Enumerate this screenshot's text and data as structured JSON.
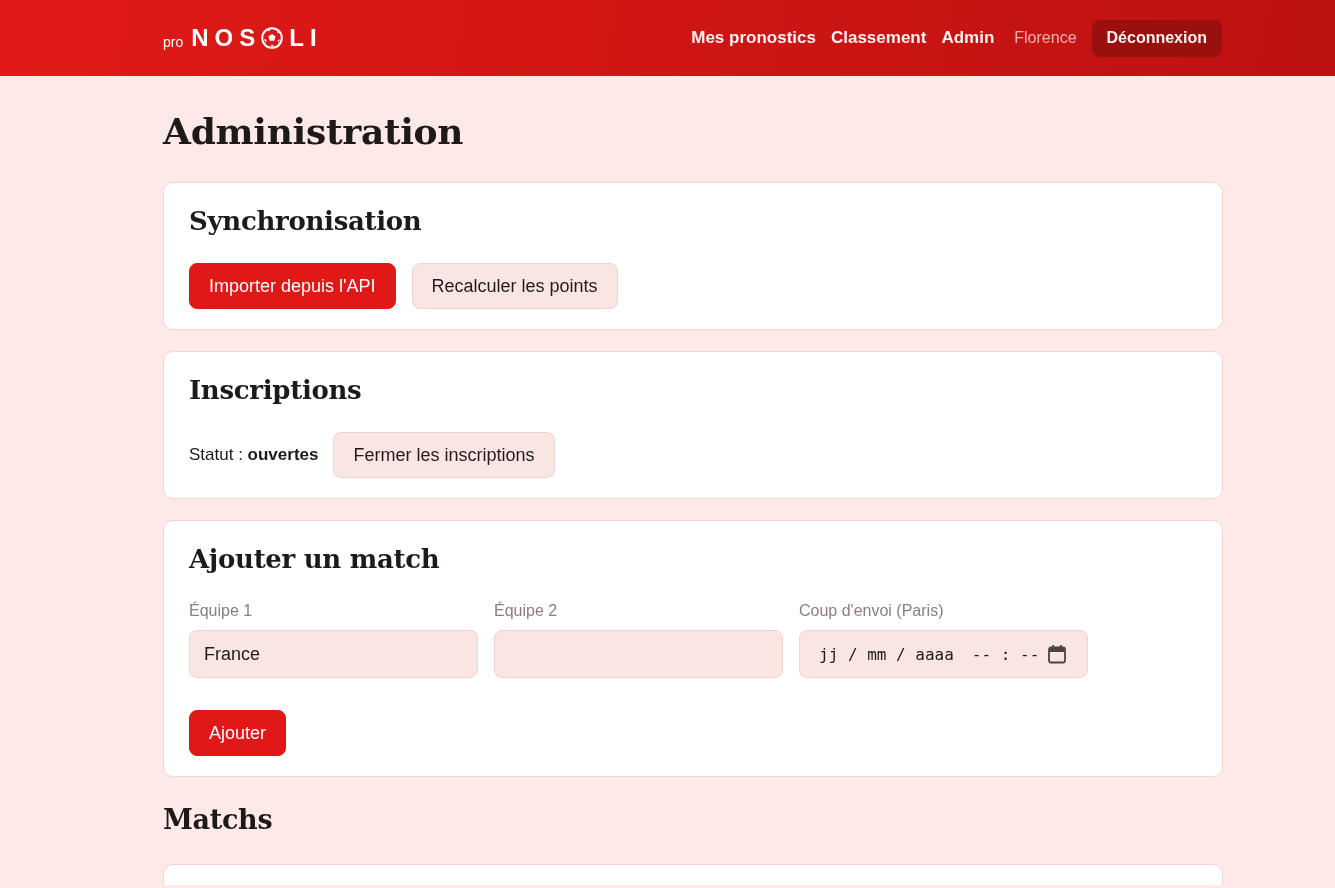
{
  "header": {
    "logo": {
      "prefix": "pro",
      "text_before_ball": "NOS",
      "text_after_ball": "LI"
    },
    "nav": [
      {
        "label": "Mes pronostics"
      },
      {
        "label": "Classement"
      },
      {
        "label": "Admin"
      }
    ],
    "user": "Florence",
    "logout_button": "Déconnexion"
  },
  "page_title": "Administration",
  "cards": [
    {
      "kind": "actions",
      "title": "Synchronisation",
      "buttons": [
        {
          "label": "Importer depuis l'API",
          "kind": "primary"
        },
        {
          "label": "Recalculer les points",
          "kind": "secondary"
        }
      ]
    },
    {
      "kind": "status",
      "title": "Inscriptions",
      "status": "Statut : **ouvertes**",
      "buttons": [
        {
          "label": "Fermer les inscriptions",
          "kind": "secondary"
        }
      ]
    },
    {
      "kind": "form",
      "title": "Ajouter un match",
      "fields": [
        {
          "kind": "text",
          "label": "Équipe 1",
          "value": "France"
        },
        {
          "kind": "text",
          "label": "Équipe 2"
        },
        {
          "kind": "datetime",
          "label": "Coup d'envoi (Paris)",
          "placeholder": {
            "date": "jj / mm / aaaa",
            "time": "-- : --"
          }
        }
      ],
      "buttons": [
        {
          "label": "Ajouter",
          "kind": "primary"
        }
      ]
    }
  ],
  "matches": {
    "title": "Matchs"
  }
}
